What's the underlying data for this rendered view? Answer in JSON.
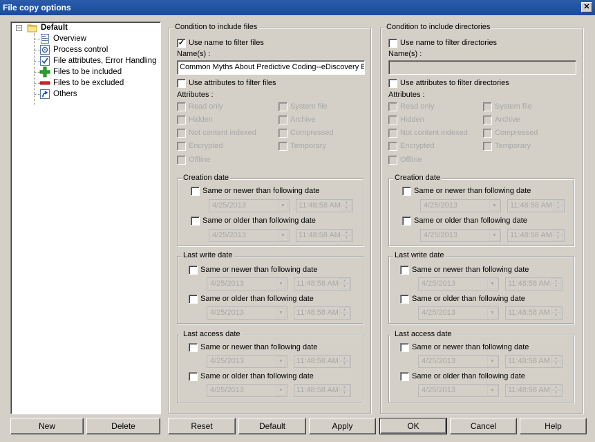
{
  "window": {
    "title": "File copy options",
    "close_label": "✕"
  },
  "tree": {
    "root": {
      "label": "Default",
      "icon": "folder-icon",
      "expander": "−"
    },
    "items": [
      {
        "label": "Overview",
        "icon": "overview-icon"
      },
      {
        "label": "Process control",
        "icon": "process-control-icon"
      },
      {
        "label": "File attributes, Error Handling",
        "icon": "checklist-icon"
      },
      {
        "label": "Files to be included",
        "icon": "green-plus-icon"
      },
      {
        "label": "Files to be excluded",
        "icon": "red-minus-icon"
      },
      {
        "label": "Others",
        "icon": "shortcut-icon"
      }
    ]
  },
  "files": {
    "title": "Condition to include files",
    "use_name_label": "Use name to filter files",
    "use_name_checked": true,
    "names_label": "Name(s) :",
    "names_value": "Common Myths About Predictive Coding--eDiscovery Be",
    "use_attr_label": "Use attributes to filter files",
    "use_attr_checked": false,
    "attributes_label": "Attributes :",
    "attributes": [
      "Read only",
      "Hidden",
      "Not content indexed",
      "Encrypted",
      "Offline",
      "System file",
      "Archive",
      "Compressed",
      "Temporary"
    ],
    "creation": {
      "title": "Creation date",
      "newer_label": "Same or newer than following date",
      "older_label": "Same or older than following date",
      "date": "4/25/2013",
      "time": "11:48:58 AM"
    },
    "last_write": {
      "title": "Last write date",
      "newer_label": "Same or newer than following date",
      "older_label": "Same or older than following date",
      "date": "4/25/2013",
      "time": "11:48:58 AM"
    },
    "last_access": {
      "title": "Last access date",
      "newer_label": "Same or newer than following date",
      "older_label": "Same or older than following date",
      "date": "4/25/2013",
      "time": "11:48:58 AM"
    }
  },
  "dirs": {
    "title": "Condition to include directories",
    "use_name_label": "Use name to filter directories",
    "use_name_checked": false,
    "names_label": "Name(s) :",
    "names_value": "",
    "use_attr_label": "Use attributes to filter directories",
    "use_attr_checked": false,
    "attributes_label": "Attributes :",
    "attributes": [
      "Read only",
      "Hidden",
      "Not content indexed",
      "Encrypted",
      "Offline",
      "System file",
      "Archive",
      "Compressed",
      "Temporary"
    ],
    "creation": {
      "title": "Creation date",
      "newer_label": "Same or newer than following date",
      "older_label": "Same or older than following date",
      "date": "4/25/2013",
      "time": "11:48:58 AM"
    },
    "last_write": {
      "title": "Last write date",
      "newer_label": "Same or newer than following date",
      "older_label": "Same or older than following date",
      "date": "4/25/2013",
      "time": "11:48:58 AM"
    },
    "last_access": {
      "title": "Last access date",
      "newer_label": "Same or newer than following date",
      "older_label": "Same or older than following date",
      "date": "4/25/2013",
      "time": "11:48:58 AM"
    }
  },
  "buttons": {
    "new": "New",
    "delete": "Delete",
    "reset": "Reset",
    "default": "Default",
    "apply": "Apply",
    "ok": "OK",
    "cancel": "Cancel",
    "help": "Help"
  },
  "colors": {
    "titlebar": "#1f52a3",
    "face": "#d4d0c8",
    "disabled_text": "#a8a8a8"
  }
}
